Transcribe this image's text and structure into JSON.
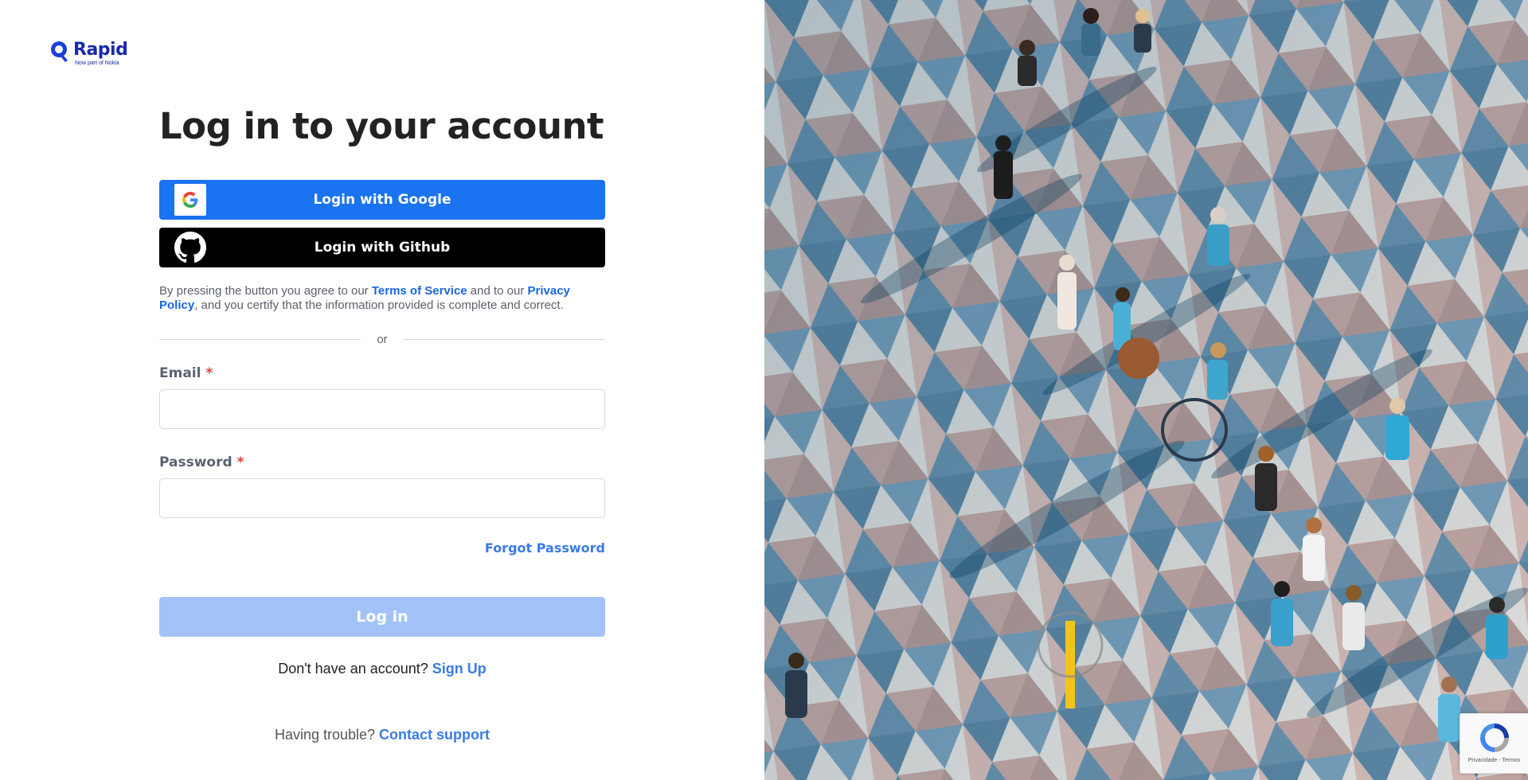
{
  "brand": {
    "name": "Rapid",
    "tagline": "Now part of Nokia",
    "color": "#1a2aa8"
  },
  "page": {
    "title": "Log in to your account"
  },
  "oauth": {
    "google_label": "Login with Google",
    "github_label": "Login with Github",
    "google_color": "#1a73f0",
    "github_color": "#000000"
  },
  "terms": {
    "prefix": "By pressing the button you agree to our ",
    "terms_link": "Terms of Service",
    "middle": " and to our ",
    "privacy_link": "Privacy Policy",
    "suffix": ", and you certify that the information provided is complete and correct."
  },
  "divider": {
    "text": "or"
  },
  "form": {
    "email_label": "Email",
    "password_label": "Password",
    "required_marker": "*",
    "email_value": "",
    "password_value": "",
    "forgot_label": "Forgot Password",
    "submit_label": "Log in",
    "submit_color": "#a3c3f8"
  },
  "signup": {
    "prompt": "Don't have an account? ",
    "link": "Sign Up"
  },
  "support": {
    "prompt": "Having trouble? ",
    "link": "Contact support"
  },
  "recaptcha": {
    "text": "Privacidade - Termos",
    "icon": "recaptcha-icon"
  },
  "hero": {
    "description_icon": "crowd-plaza-photo"
  }
}
